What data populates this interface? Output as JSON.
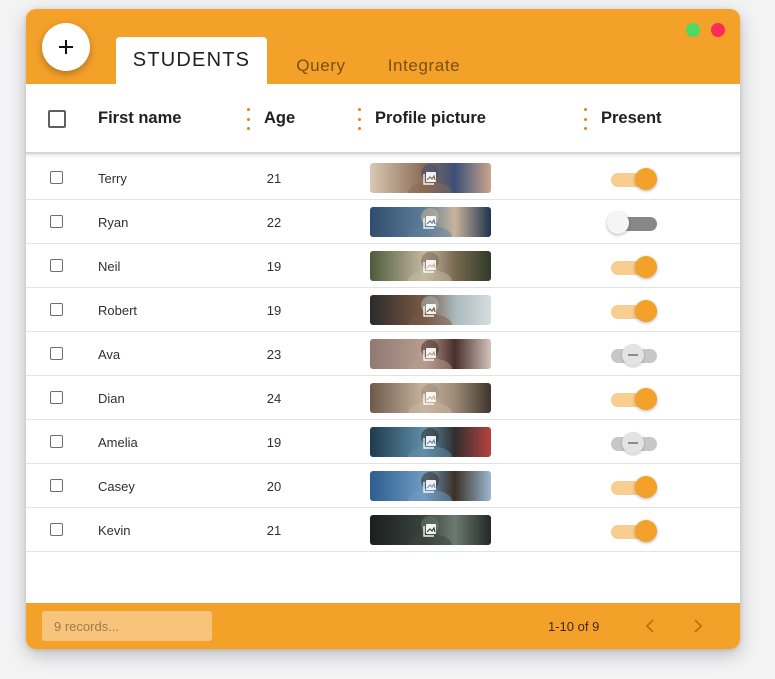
{
  "tabs": {
    "students": "STUDENTS",
    "query": "Query",
    "integrate": "Integrate"
  },
  "columns": {
    "first_name": "First name",
    "age": "Age",
    "profile_picture": "Profile picture",
    "present": "Present"
  },
  "students": [
    {
      "first_name": "Terry",
      "age": "21",
      "present": "on"
    },
    {
      "first_name": "Ryan",
      "age": "22",
      "present": "off"
    },
    {
      "first_name": "Neil",
      "age": "19",
      "present": "on"
    },
    {
      "first_name": "Robert",
      "age": "19",
      "present": "on"
    },
    {
      "first_name": "Ava",
      "age": "23",
      "present": "indeterminate"
    },
    {
      "first_name": "Dian",
      "age": "24",
      "present": "on"
    },
    {
      "first_name": "Amelia",
      "age": "19",
      "present": "indeterminate"
    },
    {
      "first_name": "Casey",
      "age": "20",
      "present": "on"
    },
    {
      "first_name": "Kevin",
      "age": "21",
      "present": "on"
    }
  ],
  "footer": {
    "search_placeholder": "9 records...",
    "pagination": "1-10 of 9"
  },
  "icons": {
    "add": "plus-icon",
    "photo": "image-icon",
    "prev": "chevron-left-icon",
    "next": "chevron-right-icon"
  },
  "colors": {
    "accent": "#f4a12a",
    "accent_light": "#f9cd8f",
    "window_close": "#fc2d55",
    "window_maximize": "#4cd964"
  }
}
